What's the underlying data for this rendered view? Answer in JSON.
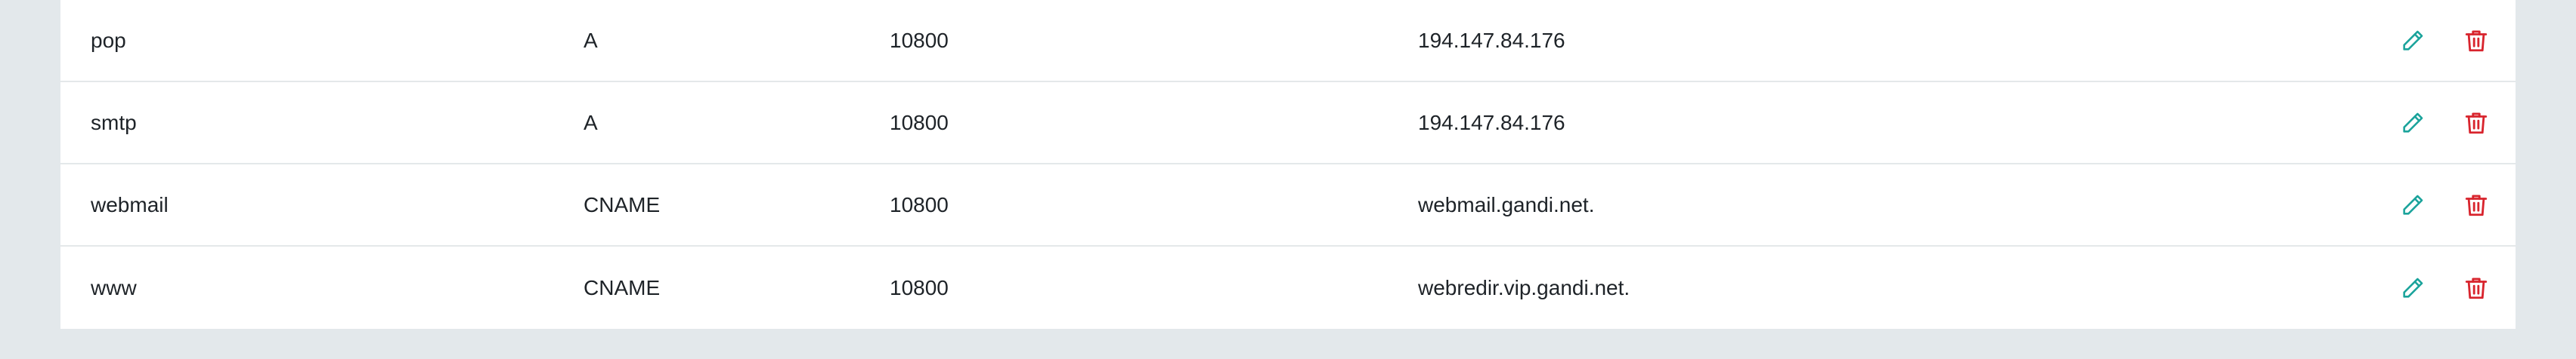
{
  "colors": {
    "background": "#e3e8eb",
    "panel": "#ffffff",
    "text": "#1e2328",
    "divider": "#e4e8ea",
    "edit_icon": "#1aa39b",
    "delete_icon": "#d8242d"
  },
  "records": [
    {
      "name": "pop",
      "type": "A",
      "ttl": "10800",
      "value": "194.147.84.176",
      "edit_icon": "pencil-icon",
      "delete_icon": "trash-icon"
    },
    {
      "name": "smtp",
      "type": "A",
      "ttl": "10800",
      "value": "194.147.84.176",
      "edit_icon": "pencil-icon",
      "delete_icon": "trash-icon"
    },
    {
      "name": "webmail",
      "type": "CNAME",
      "ttl": "10800",
      "value": "webmail.gandi.net.",
      "edit_icon": "pencil-icon",
      "delete_icon": "trash-icon"
    },
    {
      "name": "www",
      "type": "CNAME",
      "ttl": "10800",
      "value": "webredir.vip.gandi.net.",
      "edit_icon": "pencil-icon",
      "delete_icon": "trash-icon"
    }
  ]
}
